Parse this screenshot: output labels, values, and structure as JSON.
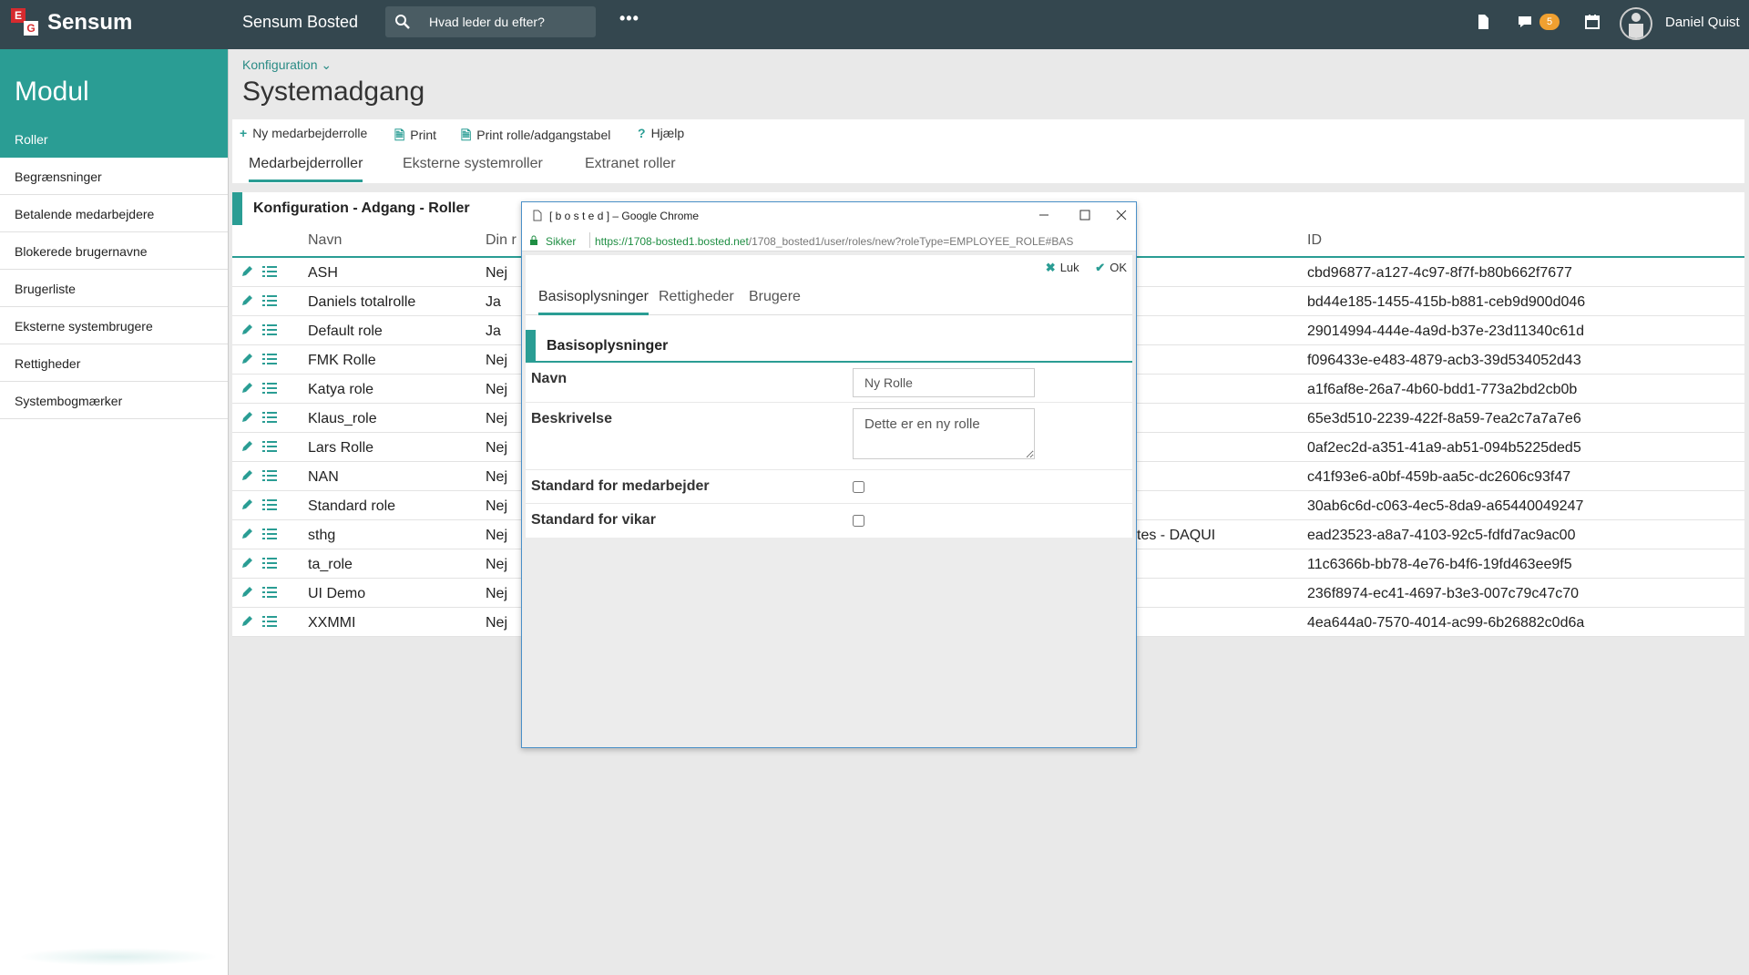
{
  "topbar": {
    "brand": "Sensum",
    "product": "Sensum Bosted",
    "search_placeholder": "Hvad leder du efter?",
    "more": "•••",
    "messages_count": "5",
    "user_name": "Daniel Quist"
  },
  "sidebar": {
    "title": "Modul",
    "items": [
      {
        "label": "Roller",
        "active": true
      },
      {
        "label": "Begrænsninger"
      },
      {
        "label": "Betalende medarbejdere"
      },
      {
        "label": "Blokerede brugernavne"
      },
      {
        "label": "Brugerliste"
      },
      {
        "label": "Eksterne systembrugere"
      },
      {
        "label": "Rettigheder"
      },
      {
        "label": "Systembogmærker"
      }
    ]
  },
  "header": {
    "breadcrumb": "Konfiguration",
    "title": "Systemadgang"
  },
  "toolbar": {
    "new_role": "Ny medarbejderrolle",
    "print": "Print",
    "print_table": "Print rolle/adgangstabel",
    "help": "Hjælp"
  },
  "tabs": [
    "Medarbejderroller",
    "Eksterne systemroller",
    "Extranet roller"
  ],
  "grid": {
    "title": "Konfiguration - Adgang - Roller",
    "columns": {
      "name": "Navn",
      "default": "Din r",
      "id": "ID"
    },
    "rows": [
      {
        "name": "ASH",
        "default": "Nej",
        "extra": "",
        "id": "cbd96877-a127-4c97-8f7f-b80b662f7677"
      },
      {
        "name": "Daniels totalrolle",
        "default": "Ja",
        "extra": "",
        "id": "bd44e185-1455-415b-b881-ceb9d900d046"
      },
      {
        "name": "Default role",
        "default": "Ja",
        "extra": "",
        "id": "29014994-444e-4a9d-b37e-23d11340c61d"
      },
      {
        "name": "FMK Rolle",
        "default": "Nej",
        "extra": "",
        "id": "f096433e-e483-4879-acb3-39d534052d43"
      },
      {
        "name": "Katya role",
        "default": "Nej",
        "extra": "",
        "id": "a1f6af8e-26a7-4b60-bdd1-773a2bd2cb0b"
      },
      {
        "name": "Klaus_role",
        "default": "Nej",
        "extra": "",
        "id": "65e3d510-2239-422f-8a59-7ea2c7a7a7e6"
      },
      {
        "name": "Lars Rolle",
        "default": "Nej",
        "extra": "",
        "id": "0af2ec2d-a351-41a9-ab51-094b5225ded5"
      },
      {
        "name": "NAN",
        "default": "Nej",
        "extra": "",
        "id": "c41f93e6-a0bf-459b-aa5c-dc2606c93f47"
      },
      {
        "name": "Standard role",
        "default": "Nej",
        "extra": "",
        "id": "30ab6c6d-c063-4ec5-8da9-a65440049247"
      },
      {
        "name": "sthg",
        "default": "Nej",
        "extra": "tes - DAQUI",
        "id": "ead23523-a8a7-4103-92c5-fdfd7ac9ac00"
      },
      {
        "name": "ta_role",
        "default": "Nej",
        "extra": "",
        "id": "11c6366b-bb78-4e76-b4f6-19fd463ee9f5"
      },
      {
        "name": "UI Demo",
        "default": "Nej",
        "extra": "",
        "id": "236f8974-ec41-4697-b3e3-007c79c47c70"
      },
      {
        "name": "XXMMI",
        "default": "Nej",
        "extra": "",
        "id": "4ea644a0-7570-4014-ac99-6b26882c0d6a"
      }
    ]
  },
  "popup": {
    "window_title": "[ b o s t e d ] – Google Chrome",
    "secure_label": "Sikker",
    "url_host": "https://1708-bosted1.bosted.net",
    "url_path": "/1708_bosted1/user/roles/new?roleType=EMPLOYEE_ROLE#BAS",
    "close_label": "Luk",
    "ok_label": "OK",
    "tabs": [
      "Basisoplysninger",
      "Rettigheder",
      "Brugere"
    ],
    "section_title": "Basisoplysninger",
    "fields": {
      "name_label": "Navn",
      "name_value": "Ny Rolle",
      "desc_label": "Beskrivelse",
      "desc_value": "Dette er en ny rolle",
      "std_employee_label": "Standard for medarbejder",
      "std_substitute_label": "Standard for vikar"
    }
  },
  "colors": {
    "topbar": "#34474f",
    "accent": "#2a9d94",
    "brand_red": "#d62b2f",
    "badge": "#f0a030"
  }
}
